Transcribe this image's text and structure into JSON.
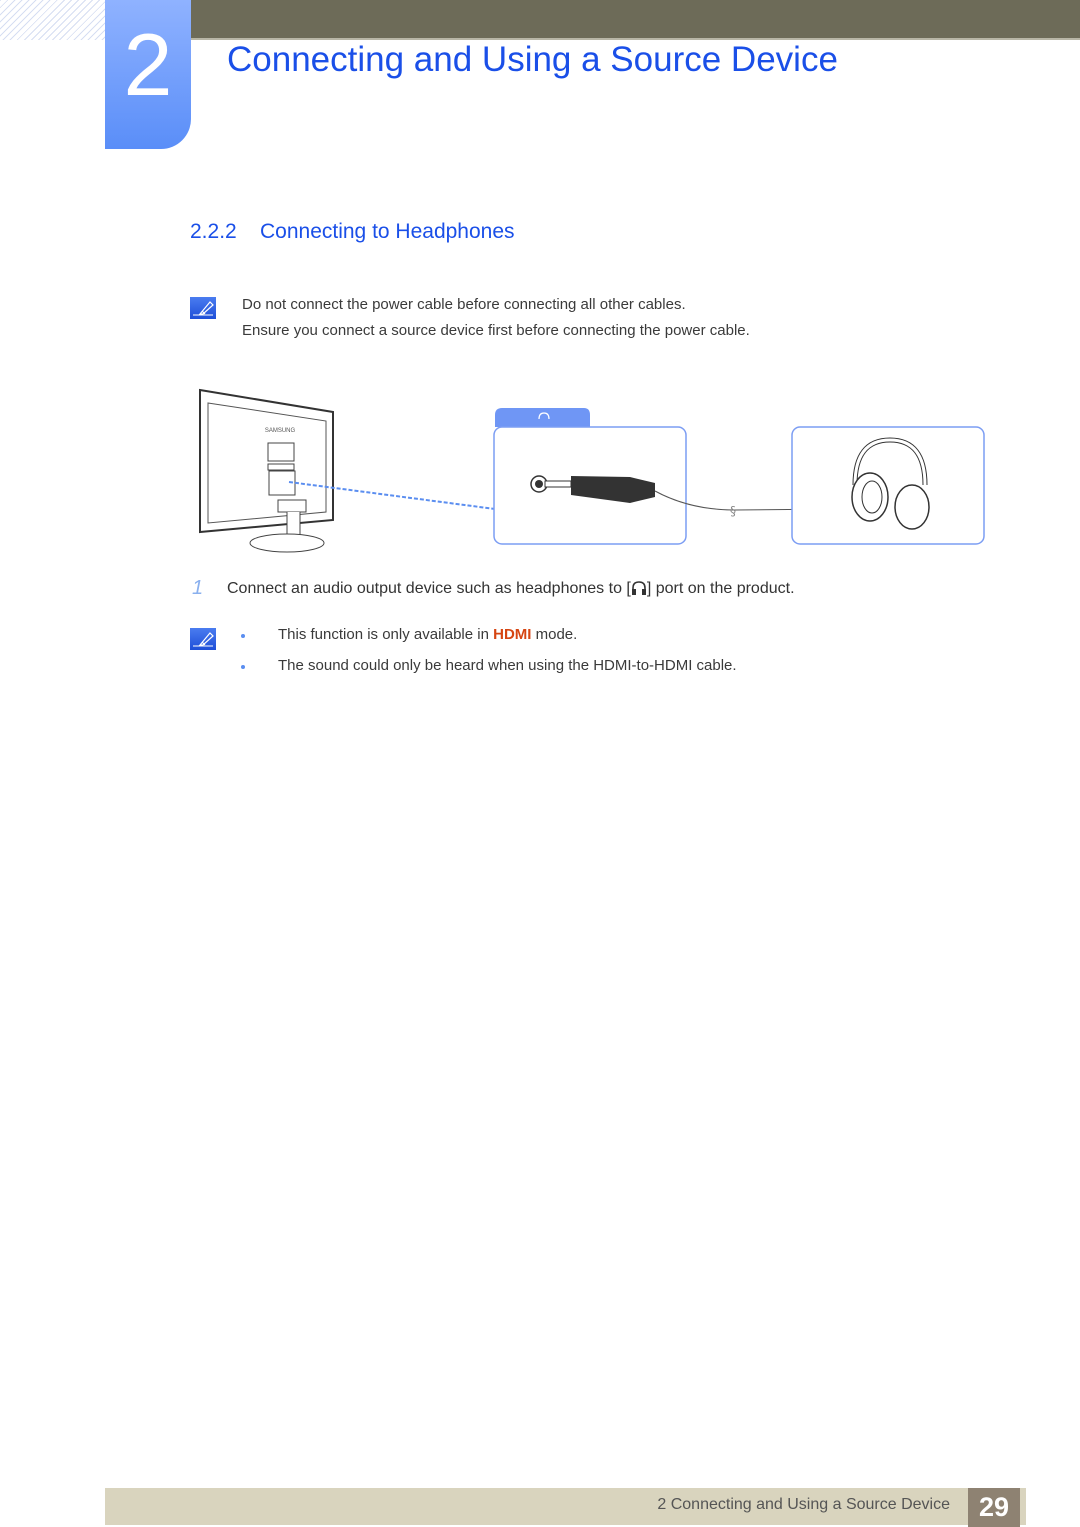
{
  "header": {
    "chapter_number": "2",
    "chapter_title": "Connecting and Using a Source Device"
  },
  "section": {
    "number": "2.2.2",
    "title": "Connecting to Headphones"
  },
  "notes_top": [
    "Do not connect the power cable before connecting all other cables.",
    "Ensure you connect a source device first before connecting the power cable."
  ],
  "diagram": {
    "monitor_brand": "SAMSUNG",
    "port_tab_icon": "headphones-icon"
  },
  "steps": [
    {
      "number": "1",
      "text_before": "Connect an audio output device such as headphones to [",
      "icon": "headphones-icon",
      "text_after": "] port on the product."
    }
  ],
  "notes_bottom": {
    "bullets": [
      {
        "before": "This function is only available in ",
        "highlight": "HDMI",
        "after": " mode."
      },
      {
        "text": "The sound could only be heard when using the HDMI-to-HDMI cable."
      }
    ]
  },
  "footer": {
    "chapter_label": "2 Connecting and Using a Source Device",
    "page_number": "29"
  },
  "colors": {
    "accent_blue": "#1a4fe8",
    "highlight_red": "#d64512",
    "topbar": "#6d6b58",
    "footer_bar": "#d9d4be",
    "page_box": "#8e8272"
  }
}
